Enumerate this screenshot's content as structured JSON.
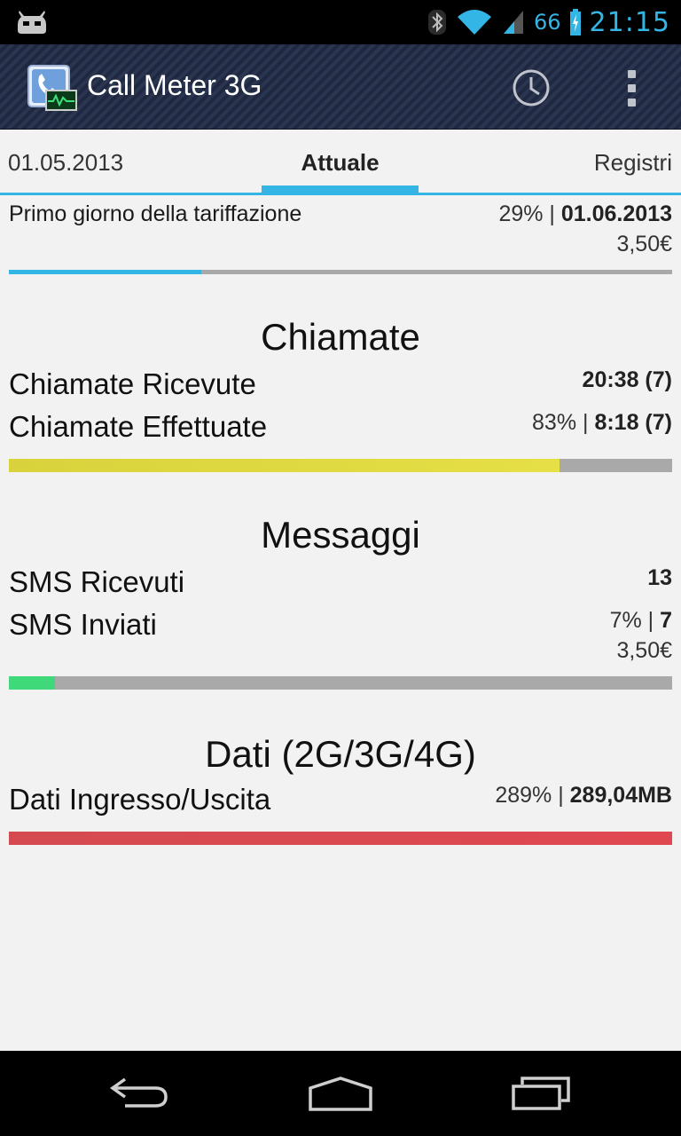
{
  "status_bar": {
    "battery_level": "66",
    "time": "21:15",
    "icons": [
      "cyanogen-robot-icon",
      "bluetooth-icon",
      "wifi-icon",
      "cell-signal-icon",
      "battery-charging-icon"
    ]
  },
  "action_bar": {
    "title": "Call Meter 3G",
    "icons": [
      "app-phone-icon",
      "history-clock-icon",
      "overflow-menu-icon"
    ]
  },
  "tabs": {
    "left": "01.05.2013",
    "center": "Attuale",
    "right": "Registri"
  },
  "billing": {
    "label": "Primo giorno della tariffazione",
    "percent": "29% | ",
    "date": "01.06.2013",
    "cost": "3,50€",
    "progress": 0.29
  },
  "calls": {
    "title": "Chiamate",
    "received_label": "Chiamate Ricevute",
    "received_value": "20:38 (7)",
    "made_label": "Chiamate Effettuate",
    "made_percent": "83% | ",
    "made_value": "8:18 (7)",
    "progress": 0.83
  },
  "messages": {
    "title": "Messaggi",
    "received_label": "SMS Ricevuti",
    "received_value": "13",
    "sent_label": "SMS Inviati",
    "sent_percent": "7% | ",
    "sent_value": "7",
    "cost": "3,50€",
    "progress": 0.07
  },
  "data": {
    "title": "Dati (2G/3G/4G)",
    "label": "Dati Ingresso/Uscita",
    "percent": "289% | ",
    "value": "289,04MB",
    "progress": 1.0
  },
  "colors": {
    "accent": "#33b5e5",
    "calls_bar": "#e0d940",
    "messages_bar": "#3fd97a",
    "data_bar": "#d84a50",
    "track": "#a9a9a9"
  },
  "nav_bar": {
    "icons": [
      "back-icon",
      "home-icon",
      "recent-apps-icon"
    ]
  }
}
